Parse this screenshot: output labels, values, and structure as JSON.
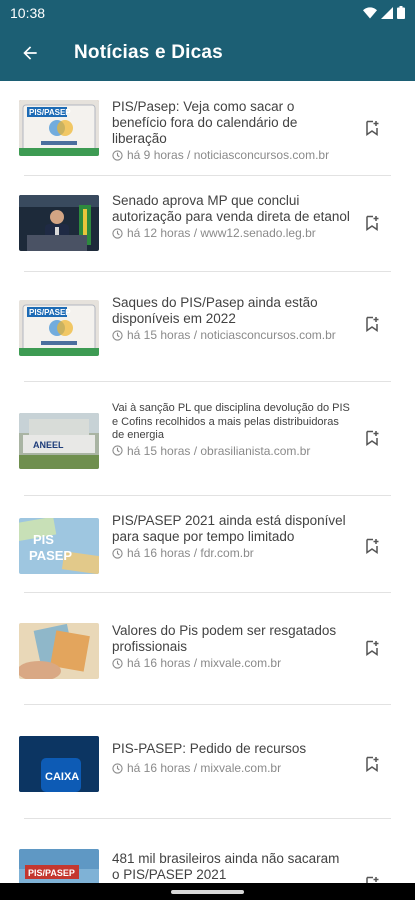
{
  "status": {
    "time": "10:38"
  },
  "app_bar": {
    "title": "Notícias e Dicas",
    "back_icon": "arrow-back-icon"
  },
  "colors": {
    "primary": "#1c5f74",
    "headline": "#424242",
    "meta": "#8a8a8a",
    "divider": "#e2e2e2"
  },
  "items": [
    {
      "headline": "PIS/Pasep: Veja como sacar o benefício fora do calendário de liberação",
      "meta": "há 9 horas / noticiasconcursos.com.br",
      "thumb_label": "PIS/PASEP"
    },
    {
      "headline": "Senado aprova MP que conclui autorização para venda direta de etanol",
      "meta": "há 12 horas / www12.senado.leg.br",
      "thumb_label": ""
    },
    {
      "headline": "Saques do PIS/Pasep ainda estão disponíveis em 2022",
      "meta": "há 15 horas / noticiasconcursos.com.br",
      "thumb_label": "PIS/PASEP"
    },
    {
      "headline": "Vai à sanção PL que disciplina devolução do PIS e Cofins recolhidos a mais pelas distribuidoras de energia",
      "meta": "há 15 horas / obrasilianista.com.br",
      "thumb_label": "ANEEL"
    },
    {
      "headline": "PIS/PASEP 2021 ainda está disponível para saque por tempo limitado",
      "meta": "há 16 horas / fdr.com.br",
      "thumb_label": "PIS PASEP"
    },
    {
      "headline": "Valores do Pis podem ser resgatados profissionais",
      "meta": "há 16 horas / mixvale.com.br",
      "thumb_label": ""
    },
    {
      "headline": "PIS-PASEP: Pedido de recursos",
      "meta": "há 16 horas / mixvale.com.br",
      "thumb_label": "CAIXA"
    },
    {
      "headline": "481 mil brasileiros ainda não sacaram o PIS/PASEP 2021",
      "meta": "",
      "thumb_label": "PIS/PASEP"
    }
  ]
}
